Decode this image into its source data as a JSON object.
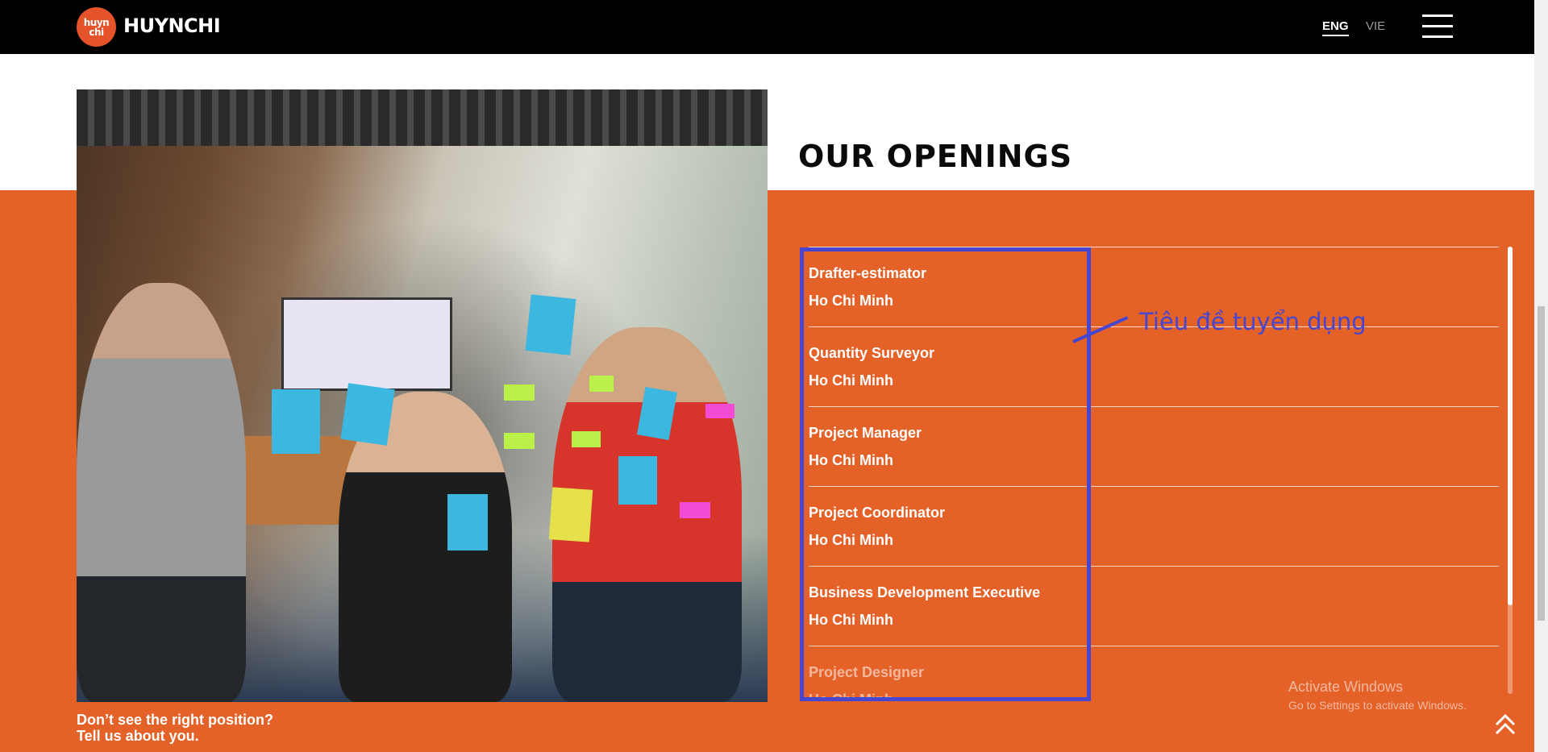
{
  "header": {
    "logo_mark_top": "huyn",
    "logo_mark_bottom": "chi",
    "brand": "HUYNCHI",
    "lang_eng": "ENG",
    "lang_vie": "VIE",
    "menu_icon": "hamburger-icon"
  },
  "main": {
    "title": "OUR OPENINGS",
    "openings": [
      {
        "title": "Drafter-estimator",
        "location": "Ho Chi Minh"
      },
      {
        "title": "Quantity Surveyor",
        "location": "Ho Chi Minh"
      },
      {
        "title": "Project Manager",
        "location": "Ho Chi Minh"
      },
      {
        "title": "Project Coordinator",
        "location": "Ho Chi Minh"
      },
      {
        "title": "Business Development Executive",
        "location": "Ho Chi Minh"
      },
      {
        "title": "Project Designer",
        "location": "Ho Chi Minh"
      }
    ],
    "cta_line1": "Don’t see the right position?",
    "cta_line2": "Tell us about you."
  },
  "annotation": {
    "label": "Tiêu đề tuyển dụng",
    "color": "#4646d0"
  },
  "watermark": {
    "line1": "Activate Windows",
    "line2": "Go to Settings to activate Windows."
  },
  "colors": {
    "accent": "#e46128",
    "header_bg": "#000000"
  },
  "icons": {
    "back_to_top": "double-chevron-up-icon"
  }
}
